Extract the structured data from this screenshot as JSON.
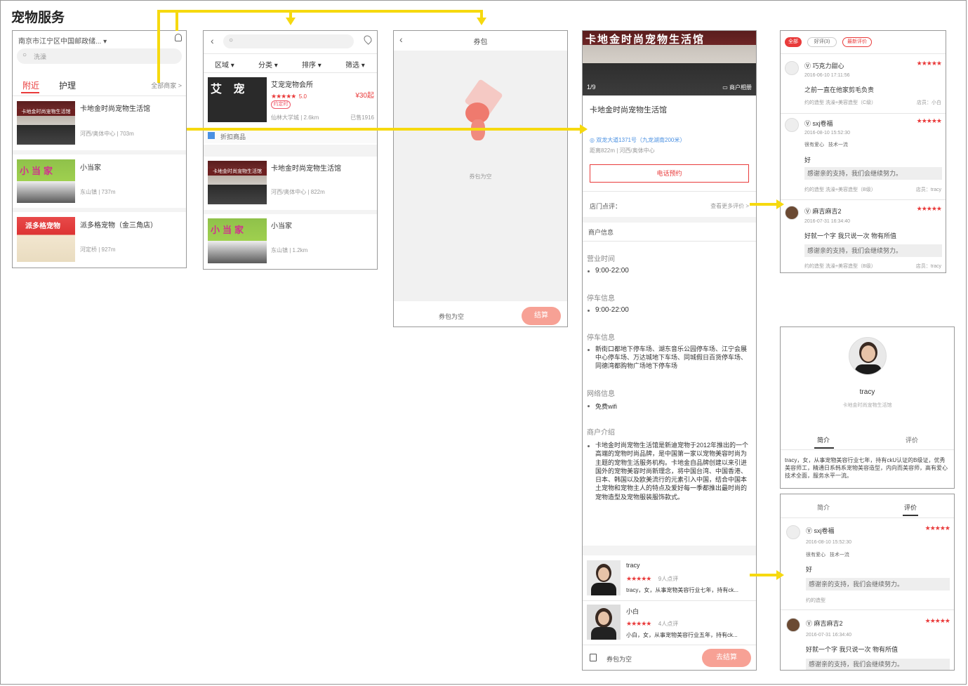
{
  "page_title": "宠物服务",
  "home": {
    "location": "南京市江宁区中国邮政储...",
    "search_placeholder": "洗澡",
    "tabs": [
      "附近",
      "护理"
    ],
    "all_shops": "全部商家 >",
    "shops": [
      {
        "name": "卡地金时尚宠物生活馆",
        "meta": "河西/奥体中心 | 703m",
        "sign": "卡地金时尚宠物生活馆"
      },
      {
        "name": "小当家",
        "meta": "东山镇 | 737m",
        "sign": "小当家"
      },
      {
        "name": "派多格宠物（金三角店）",
        "meta": "河定桥 | 927m",
        "sign": "派多格宠物"
      }
    ]
  },
  "list": {
    "filters": [
      "区域",
      "分类",
      "排序",
      "筛选"
    ],
    "shops": [
      {
        "name": "艾宠宠物会所",
        "rating": "5.0",
        "price": "¥30起",
        "tag": "约定时",
        "meta": "仙林大学城 | 2.6km",
        "sold": "已售1916",
        "sign": "艾 宠"
      },
      {
        "name": "卡地金时尚宠物生活馆",
        "meta": "河西/奥体中心 | 822m",
        "sign": "卡地金时尚宠物生活馆"
      },
      {
        "name": "小当家",
        "meta": "东山镇 | 1.2km",
        "sign": "小当家"
      }
    ],
    "discount_label": "折扣商品"
  },
  "coupon": {
    "title": "券包",
    "empty_text": "券包为空",
    "footer_empty": "券包为空",
    "checkout": "结算"
  },
  "detail": {
    "banner_sign": "卡地金时尚宠物生活馆",
    "page_indicator": "1/9",
    "album": "商户相册",
    "name": "卡地金时尚宠物生活馆",
    "address": "◎ 双龙大道1371号（九龙湖南200米）",
    "address_sub": "距离822m | 河西/奥体中心",
    "call_button": "电话预约",
    "review_label": "店门点评：",
    "review_more": "查看更多评价 >",
    "info_header": "商户信息",
    "hours_label": "营业时间",
    "hours": "9:00-22:00",
    "parking_label": "停车信息",
    "parking_hours": "9:00-22:00",
    "parking_label2": "停车信息",
    "parking_detail": "新街口都地下停车场、湖东音乐公园停车场、江宁会展中心停车场、万达城地下车场、同城假日百货停车场、同德湾都购物广场地下停车场",
    "network_label": "网络信息",
    "wifi": "免费wifi",
    "intro_label": "商户介绍",
    "intro": "卡地金时尚宠物生活馆是新迪宠物于2012年推出的一个高端的宠物时尚品牌，是中国第一家以宠物美容时尚为主题的宠物生活服务机构。卡地金自品牌创建以来引进国外的宠物美容时尚新理念，将中国台湾、中国香港、日本、韩国以及欧美流行的元素引入中国，结合中国本土宠物和宠物主人的特点及爱好每一季都推出最时尚的宠物造型及宠物服装服饰款式。",
    "groomers": [
      {
        "name": "tracy",
        "count": "9人点评",
        "desc": "tracy，女，从事宠物美容行业七年，持有ck..."
      },
      {
        "name": "小白",
        "count": "4人点评",
        "desc": "小白，女，从事宠物美容行业五年，持有ck..."
      }
    ],
    "footer_empty": "券包为空",
    "checkout": "去结算"
  },
  "reviews": {
    "tabs": [
      "全部",
      "好评(3)",
      "最新评价"
    ],
    "items": [
      {
        "user": "巧克力甜心",
        "date": "2016-06-10 17:11:56",
        "text": "之前一直在他家剪毛负责",
        "service": "约的造型 洗澡+美容造型（C级）",
        "staff": "店员：小白"
      },
      {
        "user": "sxj卷福",
        "date": "2016-08-10 15:52:30",
        "tags": [
          "很有爱心",
          "技术一流"
        ],
        "text": "好",
        "reply": "感谢亲的支持，我们会继续努力。",
        "service": "约的造型 洗澡+美容造型（B级）",
        "staff": "店员：tracy"
      },
      {
        "user": "麻吉麻吉2",
        "date": "2016-07-31 16:34:40",
        "text": "好就一个字 我只说一次 物有所值",
        "reply": "感谢亲的支持，我们会继续努力。",
        "service": "约的造型 洗澡+美容造型（B级）",
        "staff": "店员：tracy"
      }
    ]
  },
  "groomer_profile": {
    "name": "tracy",
    "subtitle": "卡地金时尚宠物生活馆",
    "tabs": [
      "简介",
      "评价"
    ],
    "bio": "tracy，女，从事宠物美容行业七年，持有ckU认证的B级证，优秀美容师工，精通日系韩系宠物美容造型，内向而美容师，高有爱心技术全面，服务水平一流。"
  },
  "groomer_reviews": {
    "tabs": [
      "简介",
      "评价"
    ],
    "items": [
      {
        "user": "sxj卷福",
        "date": "2016-08-10 15:52:30",
        "tags": [
          "很有爱心",
          "技术一流"
        ],
        "text": "好",
        "reply": "感谢亲的支持，我们会继续努力。",
        "service": "约的造型"
      },
      {
        "user": "麻吉麻吉2",
        "date": "2016-07-31 16:34:40",
        "text": "好就一个字 我只说一次 物有所值",
        "reply": "感谢亲的支持，我们会继续努力。"
      }
    ]
  },
  "stars": "★★★★★",
  "colors": {
    "accent": "#e93b3b",
    "arrow": "#f6d90f",
    "pink_button": "#f7a195"
  }
}
